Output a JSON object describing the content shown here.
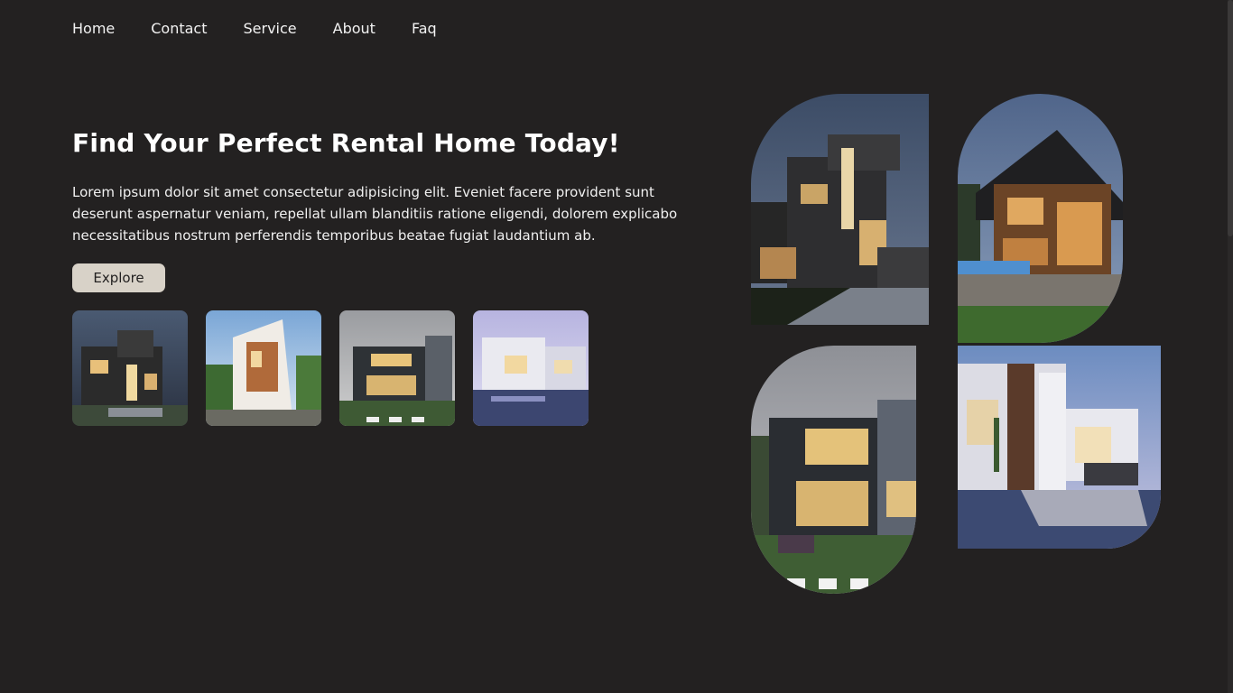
{
  "nav": {
    "items": [
      "Home",
      "Contact",
      "Service",
      "About",
      "Faq"
    ]
  },
  "hero": {
    "title": "Find Your Perfect Rental Home Today!",
    "description": "Lorem ipsum dolor sit amet consectetur adipisicing elit. Eveniet facere provident sunt deserunt aspernatur veniam, repellat ullam blanditiis ratione eligendi, dolorem explicabo necessitatibus nostrum perferendis temporibus beatae fugiat laudantium ab.",
    "button_label": "Explore"
  },
  "colors": {
    "background": "#232121",
    "button": "#d8d2c8",
    "text": "#ffffff"
  },
  "images": {
    "thumbnails": [
      "modern-house-night",
      "modern-house-wood-facade",
      "modern-house-dusk-lawn",
      "modern-house-pool-villa"
    ],
    "gallery": [
      "modern-house-night",
      "wooden-house-evening",
      "modern-house-dusk-lawn",
      "luxury-villa-pool"
    ]
  }
}
